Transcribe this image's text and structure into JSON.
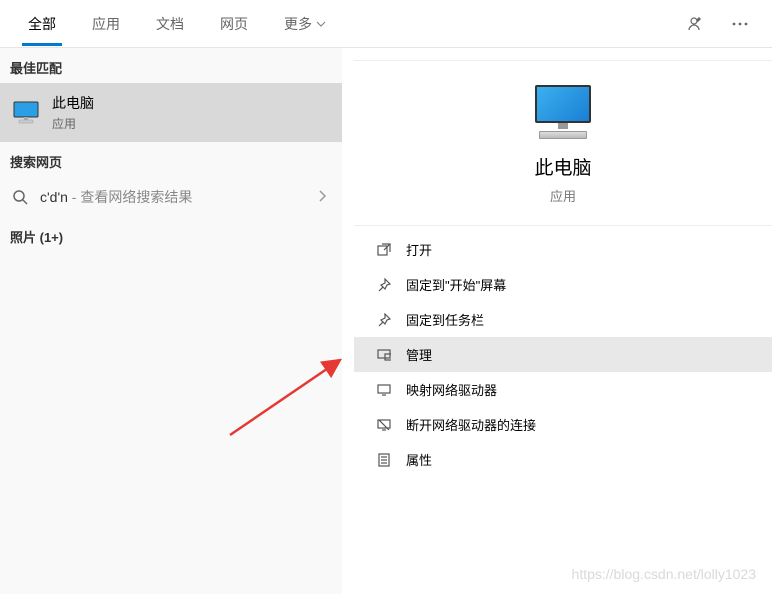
{
  "tabs": {
    "all": "全部",
    "apps": "应用",
    "docs": "文档",
    "web": "网页",
    "more": "更多"
  },
  "left": {
    "bestMatchHeader": "最佳匹配",
    "result": {
      "title": "此电脑",
      "sub": "应用"
    },
    "searchWebHeader": "搜索网页",
    "searchQuery": "c'd'n",
    "searchSuffix": " - 查看网络搜索结果",
    "photosHeader": "照片 (1+)"
  },
  "right": {
    "title": "此电脑",
    "sub": "应用",
    "actions": {
      "open": "打开",
      "pinStart": "固定到\"开始\"屏幕",
      "pinTaskbar": "固定到任务栏",
      "manage": "管理",
      "mapDrive": "映射网络驱动器",
      "disconnectDrive": "断开网络驱动器的连接",
      "properties": "属性"
    }
  },
  "watermark": "https://blog.csdn.net/lolly1023"
}
